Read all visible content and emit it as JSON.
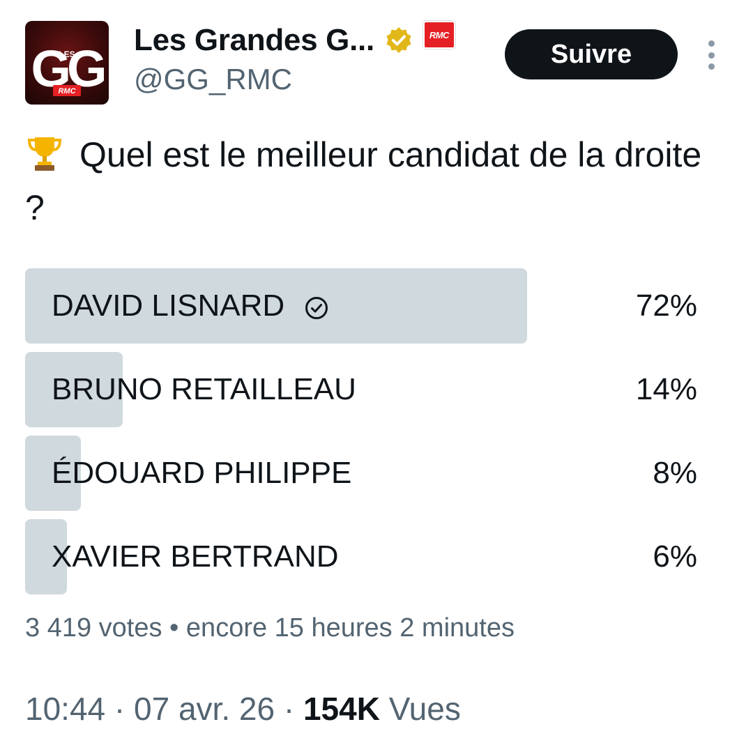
{
  "account": {
    "display_name": "Les Grandes G...",
    "handle": "@GG_RMC",
    "avatar_text_top": "GG",
    "avatar_text_small": "LES",
    "avatar_text_brand": "RMC",
    "verified_icon": "gold-verified-badge-icon",
    "affiliate_badge": "RMC"
  },
  "follow_button": {
    "label": "Suivre"
  },
  "tweet": {
    "emoji": "trophy-icon",
    "text": "Quel est le meilleur candidat de la droite ?"
  },
  "poll": {
    "options": [
      {
        "label": "DAVID LISNARD",
        "percent": "72%",
        "value": 0.72,
        "winner": true
      },
      {
        "label": "BRUNO RETAILLEAU",
        "percent": "14%",
        "value": 0.14,
        "winner": false
      },
      {
        "label": "ÉDOUARD PHILIPPE",
        "percent": "8%",
        "value": 0.08,
        "winner": false
      },
      {
        "label": "XAVIER BERTRAND",
        "percent": "6%",
        "value": 0.06,
        "winner": false
      }
    ],
    "votes": "3 419 votes",
    "separator": "•",
    "remaining": "encore 15 heures 2 minutes"
  },
  "meta": {
    "time": "10:44",
    "date": "07 avr. 26",
    "views_count": "154K",
    "views_label": "Vues",
    "separator": "·"
  },
  "colors": {
    "bar": "#cfd9de",
    "secondary_text": "#536471",
    "primary_text": "#0f1419",
    "brand_red": "#e52024"
  }
}
